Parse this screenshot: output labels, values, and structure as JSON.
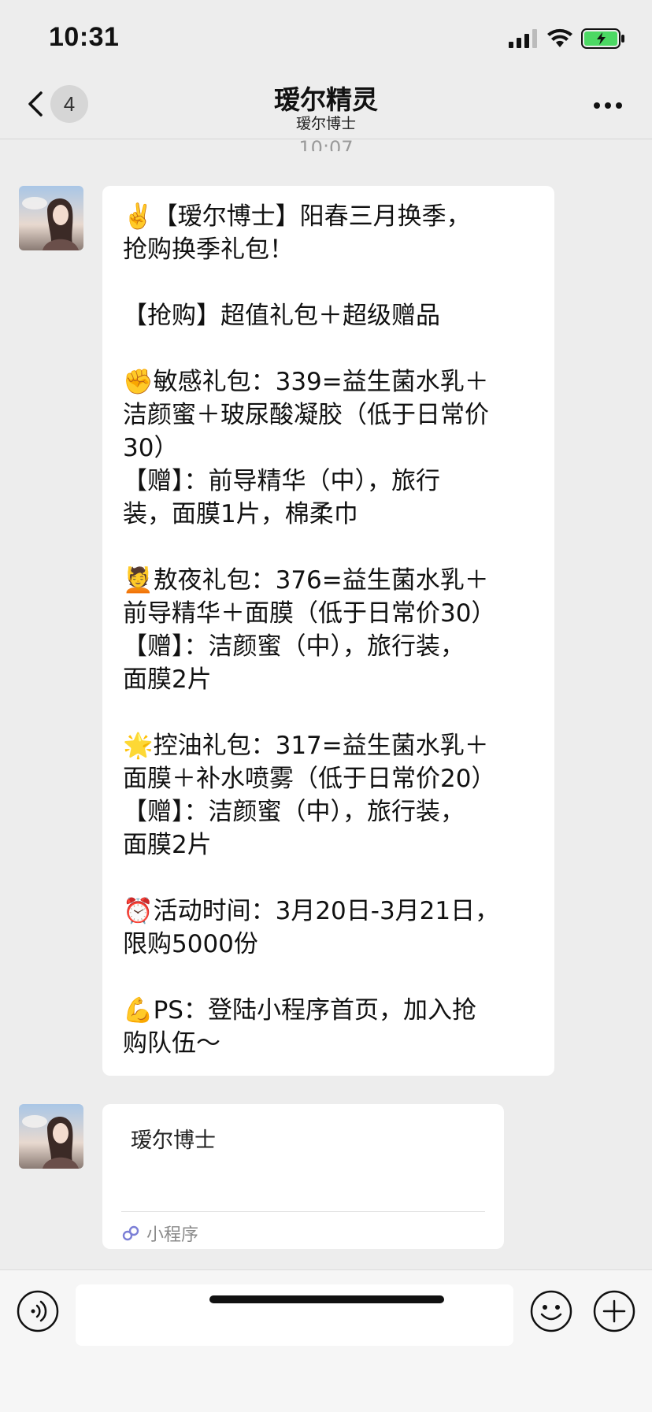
{
  "status_bar": {
    "time": "10:31"
  },
  "nav": {
    "back_badge": "4",
    "title": "瑷尔精灵",
    "subtitle": "瑷尔博士"
  },
  "partial_timestamp": "10:07",
  "message1": {
    "lines": [
      "✌️【瑷尔博士】阳春三月换季，",
      "抢购换季礼包！",
      "",
      "【抢购】超值礼包＋超级赠品",
      "",
      "✊敏感礼包：339=益生菌水乳＋",
      "洁颜蜜＋玻尿酸凝胶（低于日常价",
      "30）",
      "【赠】：前导精华（中），旅行",
      "装，面膜1片，棉柔巾",
      "",
      "💆敖夜礼包：376=益生菌水乳＋",
      "前导精华＋面膜（低于日常价30）",
      "【赠】：洁颜蜜（中），旅行装，",
      "面膜2片",
      "",
      "🌟控油礼包：317=益生菌水乳＋",
      "面膜＋补水喷雾（低于日常价20）",
      "【赠】：洁颜蜜（中），旅行装，",
      "面膜2片",
      "",
      "⏰活动时间：3月20日-3月21日，",
      "限购5000份",
      "",
      "💪PS：登陆小程序首页，加入抢",
      "购队伍～"
    ]
  },
  "message2": {
    "mini_program_title": "瑷尔博士",
    "footer_label": "小程序"
  },
  "icons": {
    "back": "chevron-left-icon",
    "more": "more-icon",
    "voice": "voice-icon",
    "emoji": "emoji-icon",
    "plus": "plus-icon",
    "mini_program": "mini-program-icon"
  },
  "colors": {
    "battery": "#4cd964",
    "background": "#ededed",
    "bubble": "#ffffff"
  }
}
